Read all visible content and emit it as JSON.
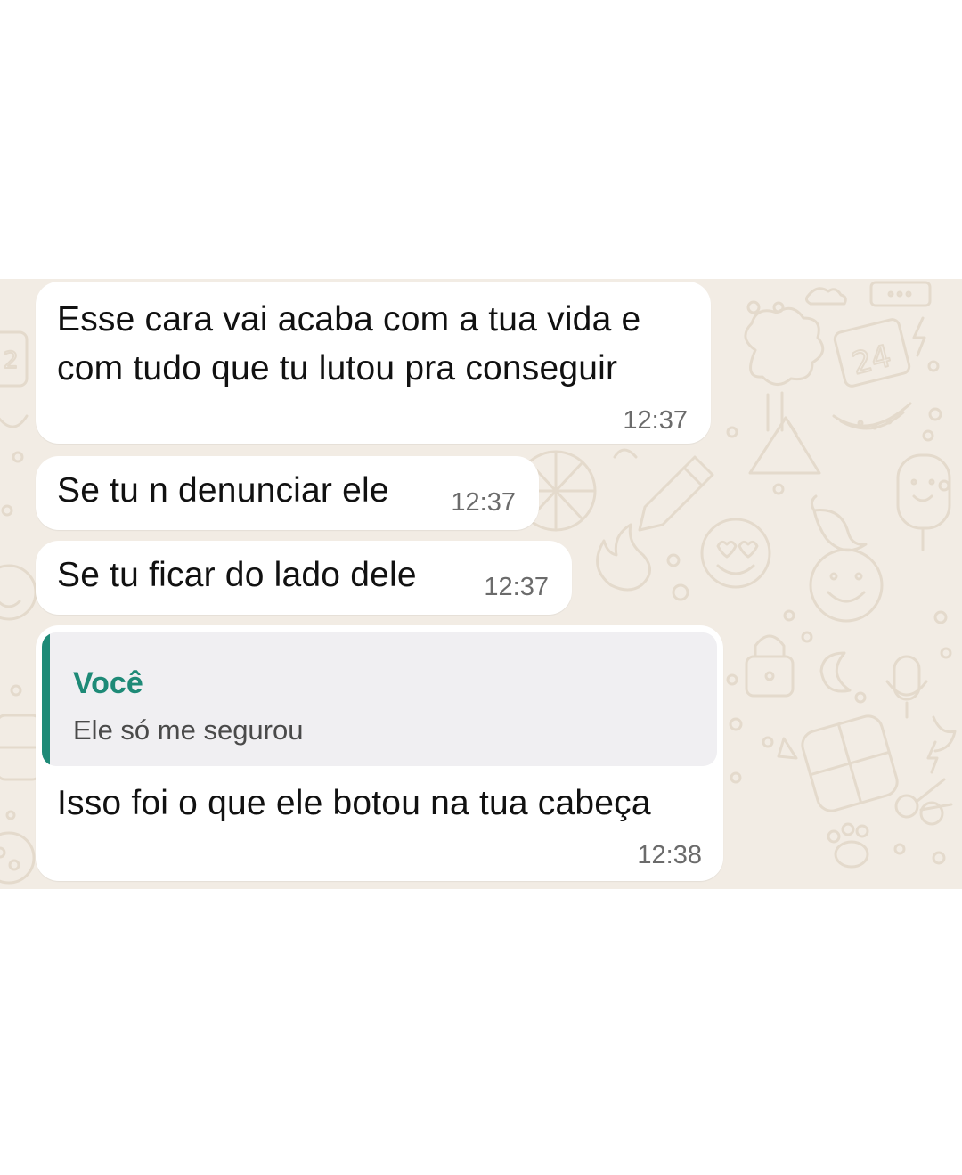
{
  "theme": {
    "wallpaper_color": "#f2ece4",
    "doodle_color": "#e4dacc",
    "bubble_color": "#ffffff",
    "quote_accent": "#1e8a77",
    "quote_background": "#f0eff2",
    "text_color": "#111111",
    "time_color": "#6b6b6b"
  },
  "messages": [
    {
      "lines": [
        "Esse cara vai acaba com a tua vida e",
        "com tudo que tu lutou pra conseguir"
      ],
      "time": "12:37"
    },
    {
      "lines": [
        "Se tu n denunciar ele"
      ],
      "time": "12:37"
    },
    {
      "lines": [
        "Se tu ficar do lado dele"
      ],
      "time": "12:37"
    },
    {
      "quoted": {
        "author": "Você",
        "text": "Ele só me segurou"
      },
      "lines": [
        "Isso foi o que ele botou na tua cabeça"
      ],
      "time": "12:38"
    }
  ],
  "wallpaper_icons": [
    "cloud-icon",
    "calendar-icon",
    "lightning-icon",
    "watermelon-icon",
    "mountain-icon",
    "pencil-icon",
    "popsicle-icon",
    "heart-eyes-emoji-icon",
    "smiley-icon",
    "fire-icon",
    "padlock-icon",
    "moon-icon",
    "microphone-icon",
    "calculator-icon",
    "paw-icon",
    "pizza-icon"
  ]
}
